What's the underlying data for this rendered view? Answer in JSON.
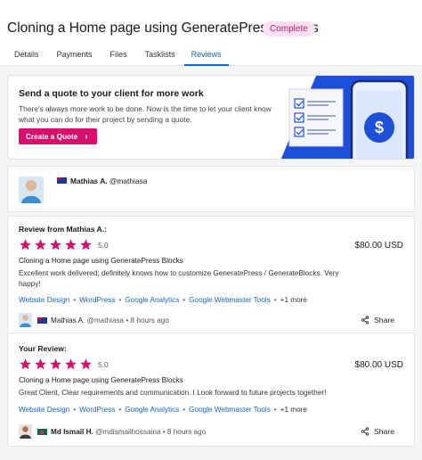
{
  "header": {
    "title": "Cloning a Home page using GeneratePress Blocks",
    "status": "Complete"
  },
  "tabs": [
    {
      "label": "Details",
      "active": false
    },
    {
      "label": "Payments",
      "active": false
    },
    {
      "label": "Files",
      "active": false
    },
    {
      "label": "Tasklists",
      "active": false
    },
    {
      "label": "Reviews",
      "active": true
    }
  ],
  "promo": {
    "heading": "Send a quote to your client for more work",
    "body": "There's always more work to be done. Now is the time to let your client know what you can do for their project by sending a quote.",
    "button": "Create a Quote",
    "button_icon": "chevron-right-icon"
  },
  "profile": {
    "name": "Mathias A.",
    "handle": "@mathiasa",
    "flag": "australia-flag-icon"
  },
  "reviews": [
    {
      "label": "Review from Mathias A.:",
      "rating": "5.0",
      "stars": 5,
      "price": "$80.00 USD",
      "project": "Cloning a Home page using GeneratePress Blocks",
      "text": "Excellent work delivered; definitely knows how to customize GeneratePress / GenerateBlocks. Very happy!",
      "skills": [
        "Website Design",
        "WordPress",
        "Google Analytics",
        "Google Webmaster Tools"
      ],
      "more": "+1 more",
      "author_name": "Mathias A.",
      "author_handle": "@mathiasa",
      "time": "8 hours ago",
      "share": "Share",
      "flag": "australia-flag-icon"
    },
    {
      "label": "Your Review:",
      "rating": "5.0",
      "stars": 5,
      "price": "$80.00 USD",
      "project": "Cloning a Home page using GeneratePress Blocks",
      "text": "Great Client, Clear requirements and communication. I Look forward to future projects together!",
      "skills": [
        "Website Design",
        "WordPress",
        "Google Analytics",
        "Google Webmaster Tools"
      ],
      "more": "+1 more",
      "author_name": "Md Ismail H.",
      "author_handle": "@mdismailhossaina",
      "time": "8 hours ago",
      "share": "Share",
      "flag": "bangladesh-flag-icon"
    }
  ],
  "colors": {
    "accent": "#d6116d",
    "star": "#d6116d",
    "link": "#1565c0",
    "promo_art": "#1d4fd8"
  }
}
